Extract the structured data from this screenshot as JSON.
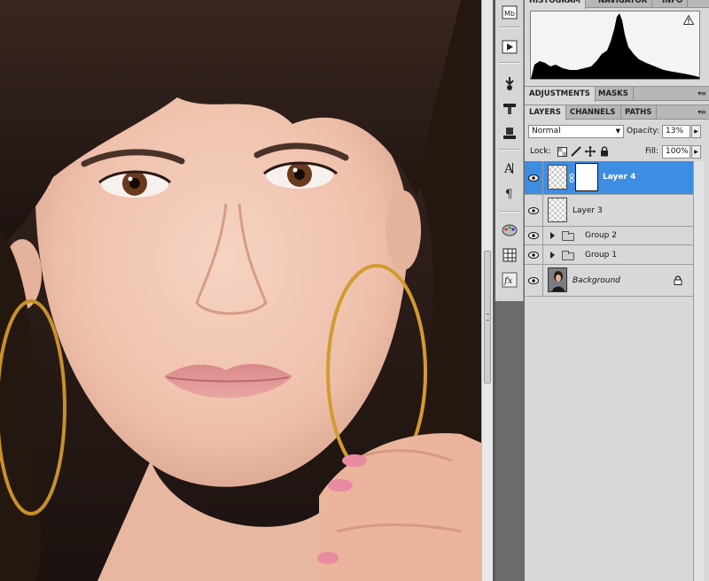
{
  "panels": {
    "top_tabs": {
      "label": "HISTOGRAM",
      "label_2": "NAVIGATOR",
      "label_3": "INFO"
    },
    "mid_tabs": {
      "adjustments": "ADJUSTMENTS",
      "masks": "MASKS"
    },
    "layer_tabs": {
      "layers": "LAYERS",
      "channels": "CHANNELS",
      "paths": "PATHS"
    },
    "menu_glyph": "▾≡",
    "warning_icon": "warning-icon"
  },
  "layers_panel": {
    "blend_mode": "Normal",
    "opacity_label": "Opacity:",
    "opacity_value": "13%",
    "lock_label": "Lock:",
    "fill_label": "Fill:",
    "fill_value": "100%",
    "layers": [
      {
        "name": "Layer 4",
        "selected": true,
        "has_mask": true,
        "type": "layer"
      },
      {
        "name": "Layer 3",
        "selected": false,
        "type": "layer"
      },
      {
        "name": "Group 2",
        "type": "group"
      },
      {
        "name": "Group 1",
        "type": "group"
      },
      {
        "name": "Background",
        "type": "background",
        "locked": true
      }
    ]
  },
  "toolbar_icons": [
    "mini-bridge-icon",
    "play-actions-icon",
    "brush-settings-icon",
    "clone-source-icon",
    "tool-presets-icon",
    "character-icon",
    "paragraph-icon",
    "swatches-icon",
    "styles-icon",
    "fx-icon"
  ],
  "colors": {
    "selection": "#3d8ee3",
    "panel": "#d8d8d8",
    "tabbar": "#b7b7b7",
    "background_gray": "#6b6b6b"
  }
}
